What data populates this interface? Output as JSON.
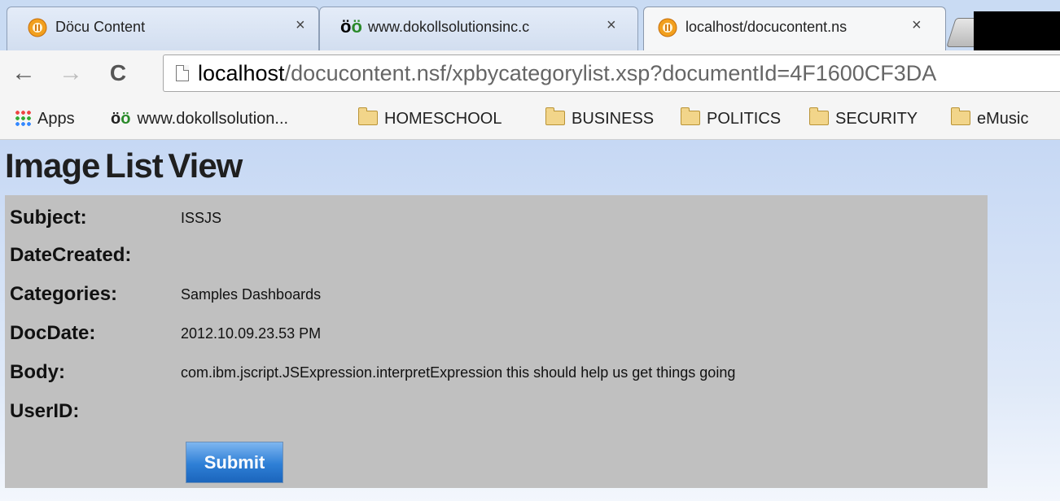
{
  "browser": {
    "tabs": [
      {
        "title": "Döcu Content",
        "close": "×",
        "active": false
      },
      {
        "title": "www.dokollsolutionsinc.c",
        "close": "×",
        "active": false
      },
      {
        "title": "localhost/docucontent.ns",
        "close": "×",
        "active": true
      }
    ],
    "nav": {
      "back": "←",
      "forward": "→",
      "reload": "C"
    },
    "url": {
      "host": "localhost",
      "path": "/docucontent.nsf/xpbycategorylist.xsp?documentId=4F1600CF3DA"
    },
    "bookmarks": [
      {
        "label": "Apps",
        "icon": "apps-grid-icon"
      },
      {
        "label": "www.dokollsolution...",
        "icon": "oo-logo-icon"
      },
      {
        "label": "HOMESCHOOL",
        "icon": "folder-icon"
      },
      {
        "label": "BUSINESS",
        "icon": "folder-icon"
      },
      {
        "label": "POLITICS",
        "icon": "folder-icon"
      },
      {
        "label": "SECURITY",
        "icon": "folder-icon"
      },
      {
        "label": "eMusic",
        "icon": "folder-icon"
      }
    ]
  },
  "page": {
    "heading": "Image List View",
    "fields": [
      {
        "label": "Subject:",
        "value": "ISSJS"
      },
      {
        "label": "DateCreated:",
        "value": ""
      },
      {
        "label": "Categories:",
        "value": "Samples Dashboards"
      },
      {
        "label": "DocDate:",
        "value": "2012.10.09.23.53 PM"
      },
      {
        "label": "Body:",
        "value": "com.ibm.jscript.JSExpression.interpretExpression  this should help us get things going"
      },
      {
        "label": "UserID:",
        "value": ""
      }
    ],
    "submit_label": "Submit"
  },
  "colors": {
    "panel": "#c0c0c0",
    "page_bg": "#c6d8f4",
    "submit": "#2e7fd6"
  }
}
